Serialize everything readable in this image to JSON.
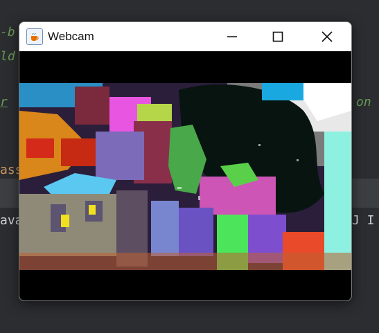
{
  "window": {
    "title": "Webcam",
    "app_icon": "java-coffee-cup-icon",
    "controls": {
      "minimize": "minimize-icon",
      "maximize": "maximize-icon",
      "close": "close-icon"
    }
  },
  "ide_background": {
    "line1_left": "-b",
    "line2_left": "ld",
    "line3_left": "r",
    "line3_right": "on",
    "line5_left": "ass",
    "line6_left": "ava",
    "line6_right": "J I"
  },
  "colors": {
    "ide_bg": "#2b2d30",
    "ide_comment": "#6a9955",
    "ide_keyword": "#d19a66",
    "titlebar_bg": "#ffffff",
    "video_bg": "#000000"
  }
}
